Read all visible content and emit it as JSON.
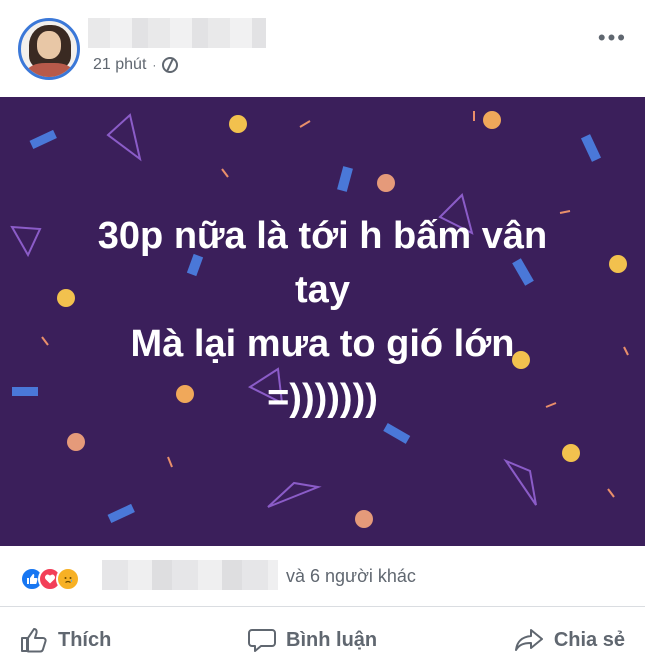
{
  "post": {
    "time": "21 phút",
    "separator": "·",
    "privacy_icon": "globe-icon",
    "more_icon": "more-options-icon",
    "more_label": "•••"
  },
  "banner": {
    "background": "#3b1f5b",
    "lines": [
      "30p nữa là tới h bấm vân",
      "tay",
      "Mà lại mưa to gió lớn",
      "=)))))))"
    ]
  },
  "reactions": {
    "icons": [
      "like-icon",
      "love-icon",
      "sad-icon"
    ],
    "summary": "và 6 người khác"
  },
  "actions": {
    "like": "Thích",
    "comment": "Bình luận",
    "share": "Chia sẻ"
  }
}
